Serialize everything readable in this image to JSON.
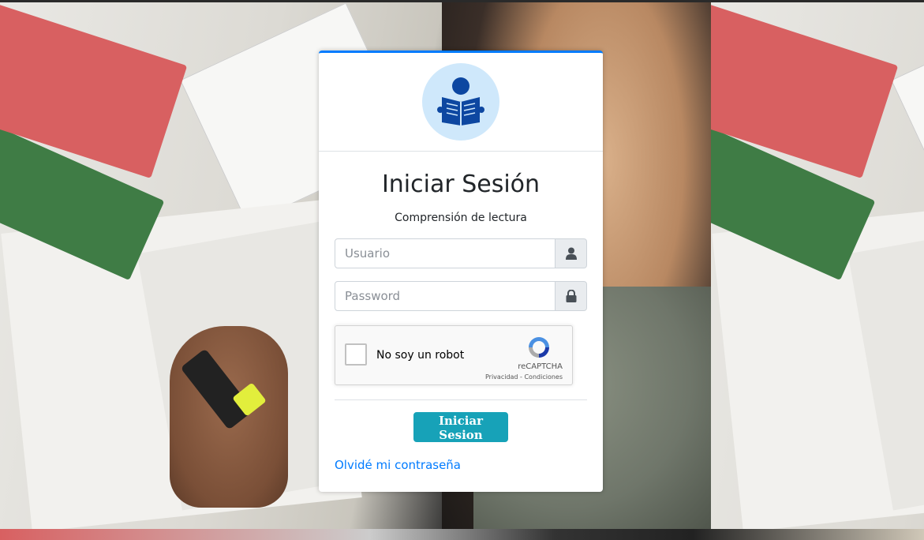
{
  "login": {
    "title": "Iniciar Sesión",
    "subtitle": "Comprensión de lectura",
    "username_placeholder": "Usuario",
    "password_placeholder": "Password",
    "submit_label": "Iniciar Sesion",
    "forgot_label": "Olvidé mi contraseña"
  },
  "captcha": {
    "label": "No soy un robot",
    "brand": "reCAPTCHA",
    "links": "Privacidad - Condiciones"
  },
  "icons": {
    "logo": "reading-person-icon",
    "username_addon": "user-icon",
    "password_addon": "lock-icon"
  },
  "colors": {
    "accent": "#007bff",
    "button": "#17a2b8",
    "logo_bg": "#cfe8fb",
    "logo_fg": "#0d47a1"
  }
}
